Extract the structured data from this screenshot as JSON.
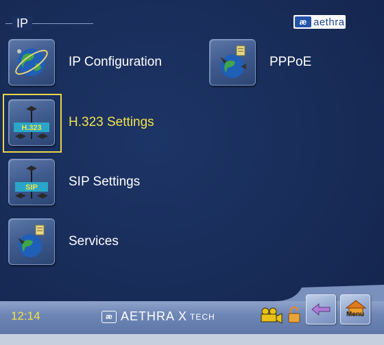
{
  "header": {
    "title": "IP",
    "brand_mark": "æ",
    "brand_name": "aethra"
  },
  "menu": {
    "items": [
      {
        "label": "IP Configuration",
        "icon": "globe-icon"
      },
      {
        "label": "PPPoE",
        "icon": "globe-satellite-icon"
      },
      {
        "label": "H.323 Settings",
        "icon": "h323-network-icon",
        "selected": true,
        "badge": "H.323"
      },
      {
        "label": "SIP Settings",
        "icon": "sip-network-icon",
        "badge": "SIP"
      },
      {
        "label": "Services",
        "icon": "globe-services-icon"
      }
    ]
  },
  "footer": {
    "time": "12:14",
    "brand_mark": "æ",
    "brand_name": "AETHRA X",
    "brand_suffix": "TECH",
    "menu_label": "Menu"
  },
  "colors": {
    "selected_text": "#f2e34a",
    "background": "#182c58"
  }
}
